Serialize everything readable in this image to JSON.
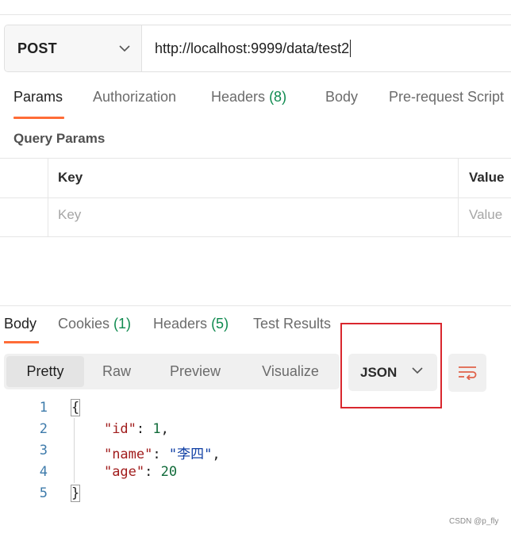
{
  "request": {
    "method": "POST",
    "url": "http://localhost:9999/data/test2"
  },
  "request_tabs": {
    "params": "Params",
    "authorization": "Authorization",
    "headers_label": "Headers",
    "headers_count": "(8)",
    "body": "Body",
    "prerequest": "Pre-request Script"
  },
  "query_params": {
    "title": "Query Params",
    "col_key": "Key",
    "col_value": "Value",
    "key_placeholder": "Key",
    "value_placeholder": "Value"
  },
  "response_tabs": {
    "body": "Body",
    "cookies_label": "Cookies",
    "cookies_count": "(1)",
    "headers_label": "Headers",
    "headers_count": "(5)",
    "test_results": "Test Results"
  },
  "view_modes": {
    "pretty": "Pretty",
    "raw": "Raw",
    "preview": "Preview",
    "visualize": "Visualize"
  },
  "format": {
    "selected": "JSON"
  },
  "code": {
    "line_numbers": [
      "1",
      "2",
      "3",
      "4",
      "5"
    ],
    "open_brace": "{",
    "close_brace": "}",
    "id_key": "\"id\"",
    "id_value": "1",
    "name_key": "\"name\"",
    "name_value": "\"李四\"",
    "age_key": "\"age\"",
    "age_value": "20"
  },
  "colors": {
    "accent": "#ff6c37",
    "count_green": "#0f8a4f",
    "highlight_red": "#d9272e"
  },
  "watermark": "CSDN @p_fly"
}
